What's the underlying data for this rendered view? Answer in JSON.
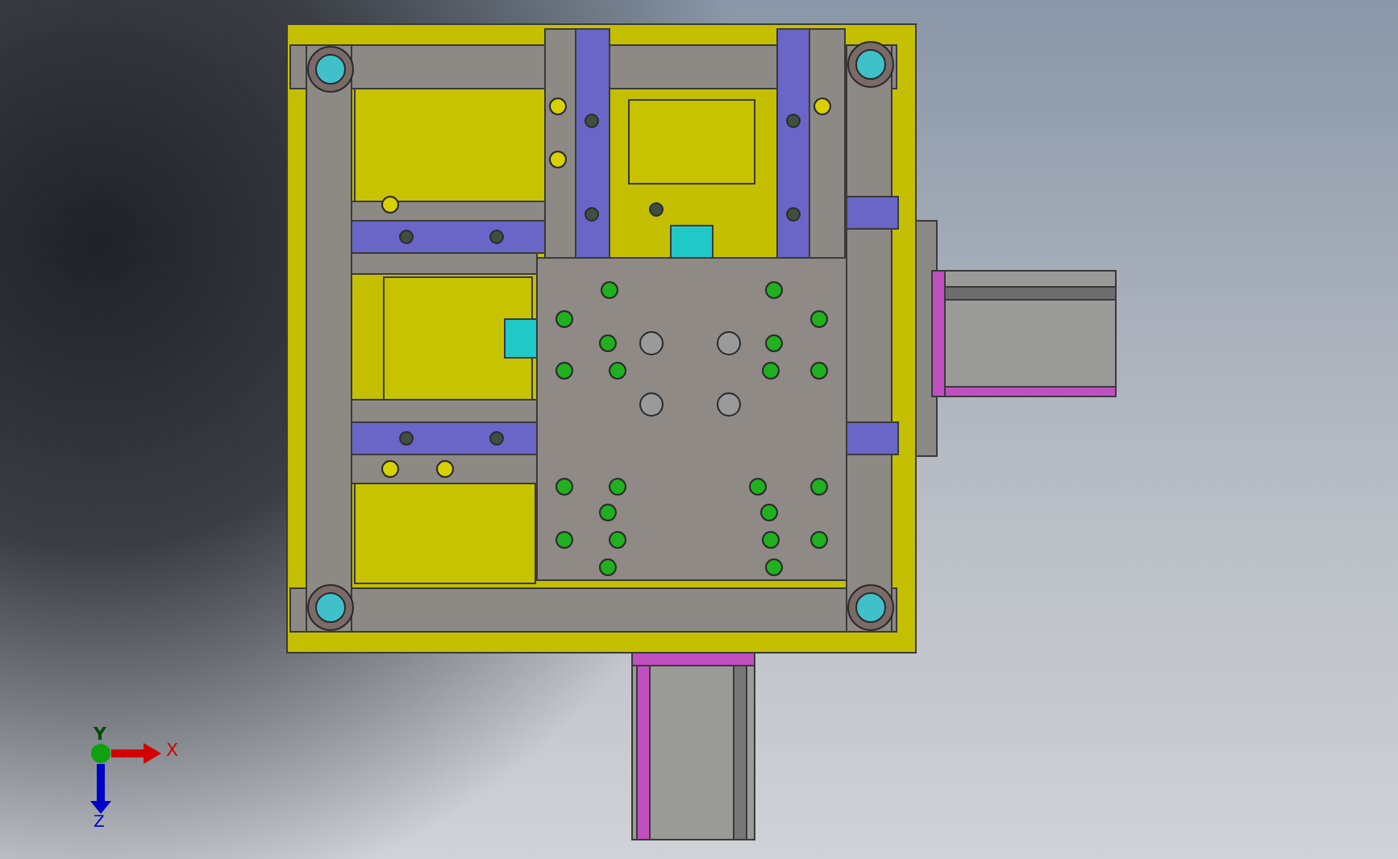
{
  "viewport": {
    "triad": {
      "axes": [
        {
          "kind": "x",
          "label": "X",
          "color": "#d40000"
        },
        {
          "kind": "y",
          "label": "Y",
          "color": "#10a010"
        },
        {
          "kind": "z",
          "label": "Z",
          "color": "#0000c8"
        }
      ]
    }
  }
}
